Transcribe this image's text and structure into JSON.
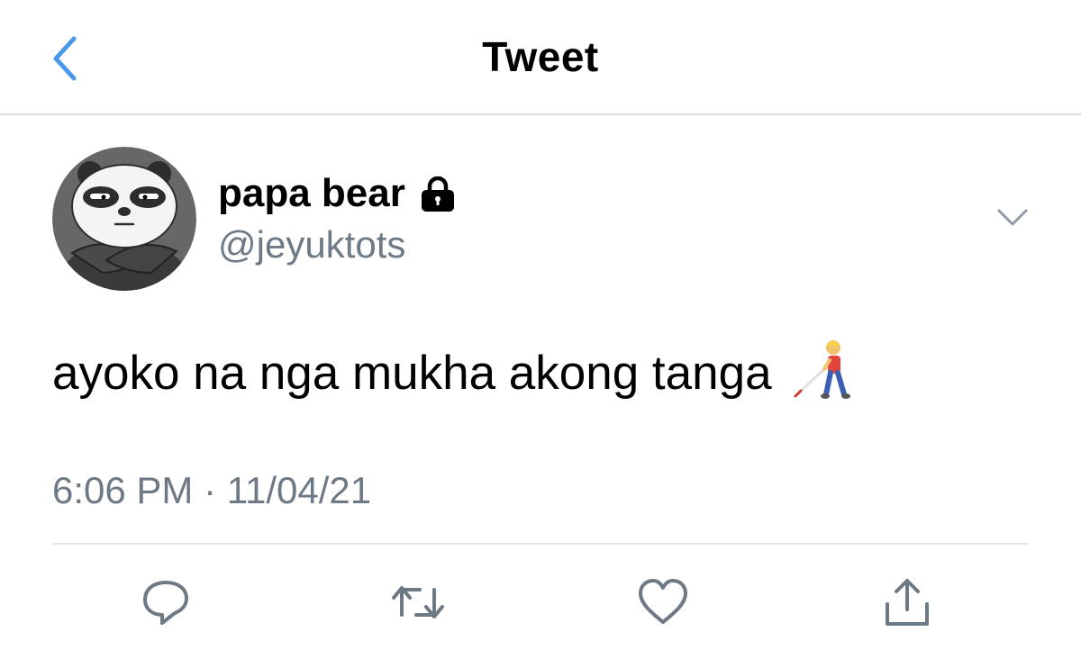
{
  "header": {
    "title": "Tweet",
    "back_icon": "chevron-left-icon",
    "accent_color": "#4a98e9"
  },
  "tweet": {
    "author": {
      "name": "papa bear",
      "handle": "@jeyuktots",
      "protected_icon": "lock-icon",
      "avatar_icon": "panda-avatar-icon"
    },
    "text": "ayoko na nga mukha akong tanga",
    "emoji_icon": "person-with-white-cane-icon",
    "timestamp": "6:06 PM · 11/04/21",
    "menu_icon": "chevron-down-icon"
  },
  "actions": [
    {
      "name": "reply",
      "icon": "speech-bubble-icon"
    },
    {
      "name": "retweet",
      "icon": "retweet-icon"
    },
    {
      "name": "like",
      "icon": "heart-icon"
    },
    {
      "name": "share",
      "icon": "share-icon"
    }
  ],
  "colors": {
    "text_primary": "#000000",
    "text_secondary": "#6d7a86",
    "icon_gray": "#6d7a86",
    "divider": "#e1e6ea"
  }
}
